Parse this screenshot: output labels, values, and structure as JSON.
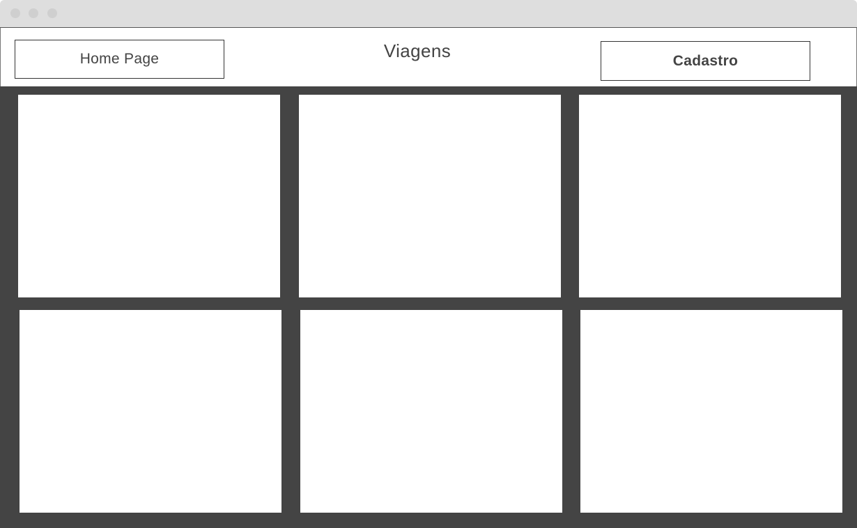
{
  "window": {
    "controls": [
      "close-dot",
      "minimize-dot",
      "maximize-dot"
    ]
  },
  "header": {
    "home_label": "Home Page",
    "title": "Viagens",
    "cadastro_label": "Cadastro"
  },
  "grid": {
    "card_count": 6
  },
  "colors": {
    "background_dark": "#444444",
    "titlebar": "#dedede",
    "card": "#ffffff",
    "text": "#444444"
  }
}
